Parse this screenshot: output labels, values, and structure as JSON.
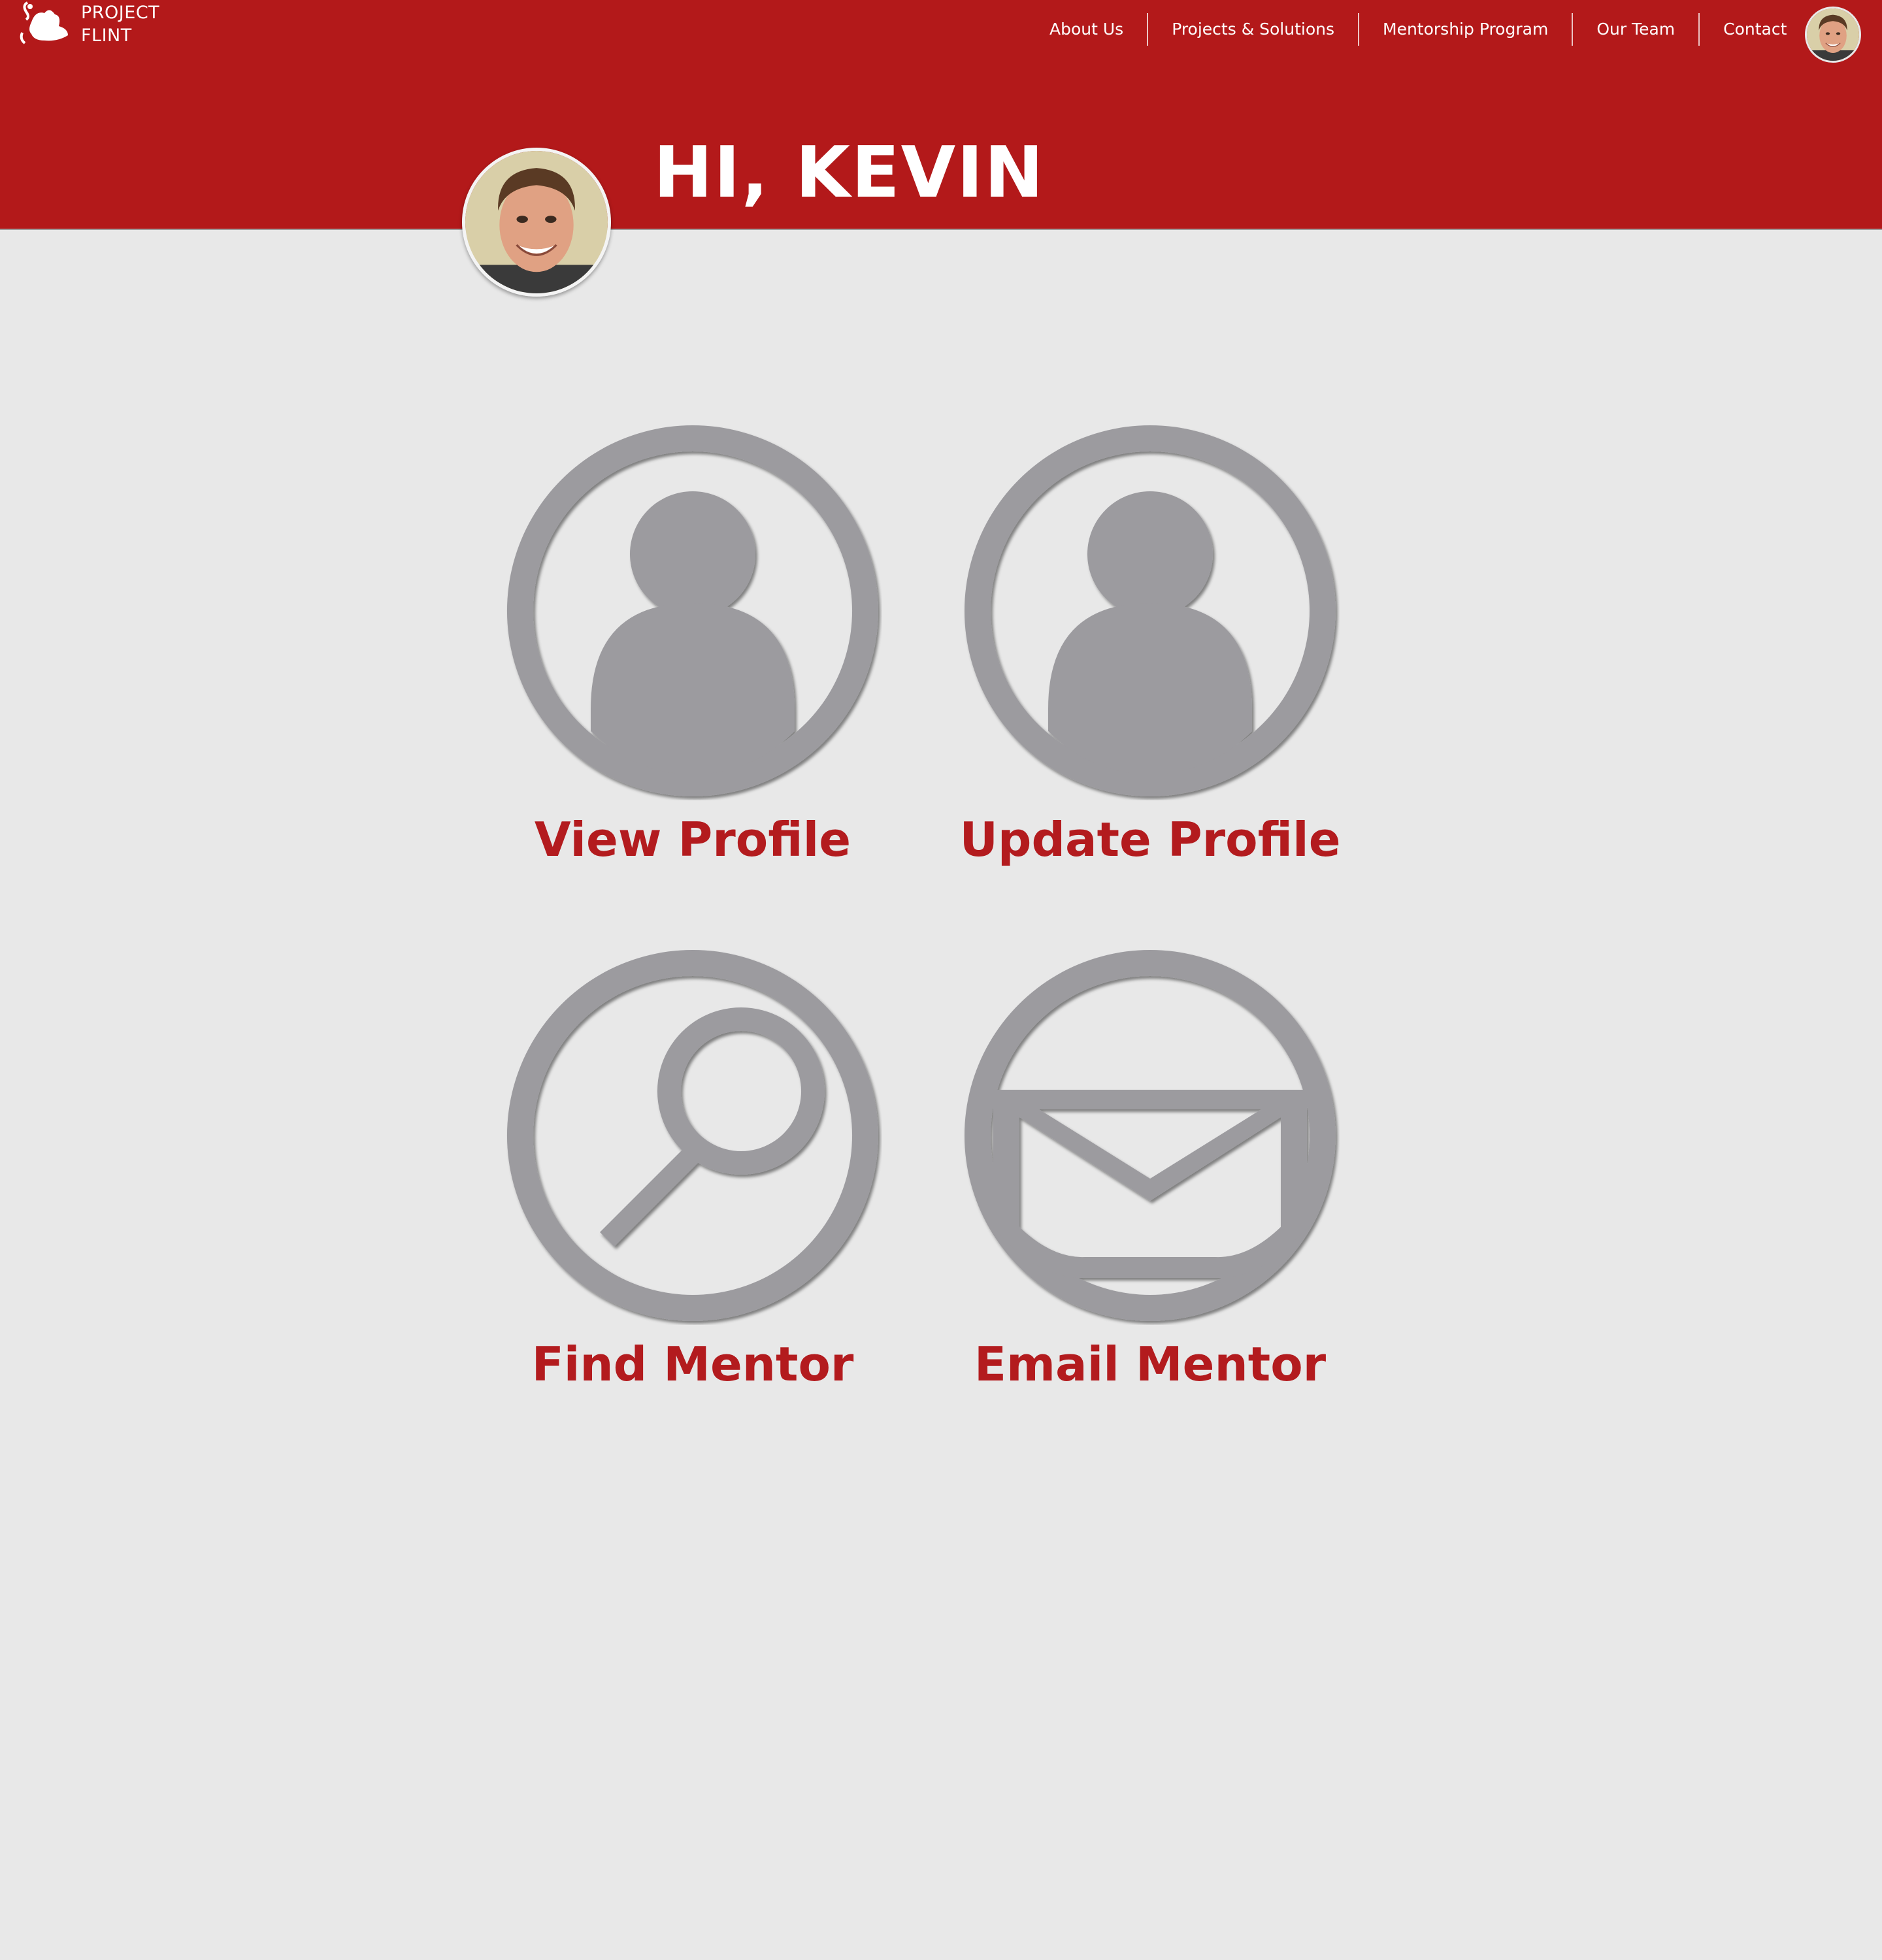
{
  "brand": {
    "line1": "PROJECT",
    "line2": "FLINT",
    "logo_icon": "boot-logo-icon"
  },
  "nav": {
    "items": [
      {
        "label": "About Us"
      },
      {
        "label": "Projects & Solutions"
      },
      {
        "label": "Mentorship Program"
      },
      {
        "label": "Our Team"
      },
      {
        "label": "Contact"
      }
    ],
    "avatar_icon": "user-avatar"
  },
  "greeting": "HI, KEVIN",
  "tiles": [
    {
      "label": "View Profile",
      "icon": "person-icon"
    },
    {
      "label": "Update Profile",
      "icon": "person-icon"
    },
    {
      "label": "Find Mentor",
      "icon": "magnifier-icon"
    },
    {
      "label": "Email Mentor",
      "icon": "envelope-icon"
    }
  ],
  "colors": {
    "header": "#b3191a",
    "background": "#e8e8e8",
    "accent_text": "#b31b1e",
    "icon_gray": "#9c9b9f"
  }
}
